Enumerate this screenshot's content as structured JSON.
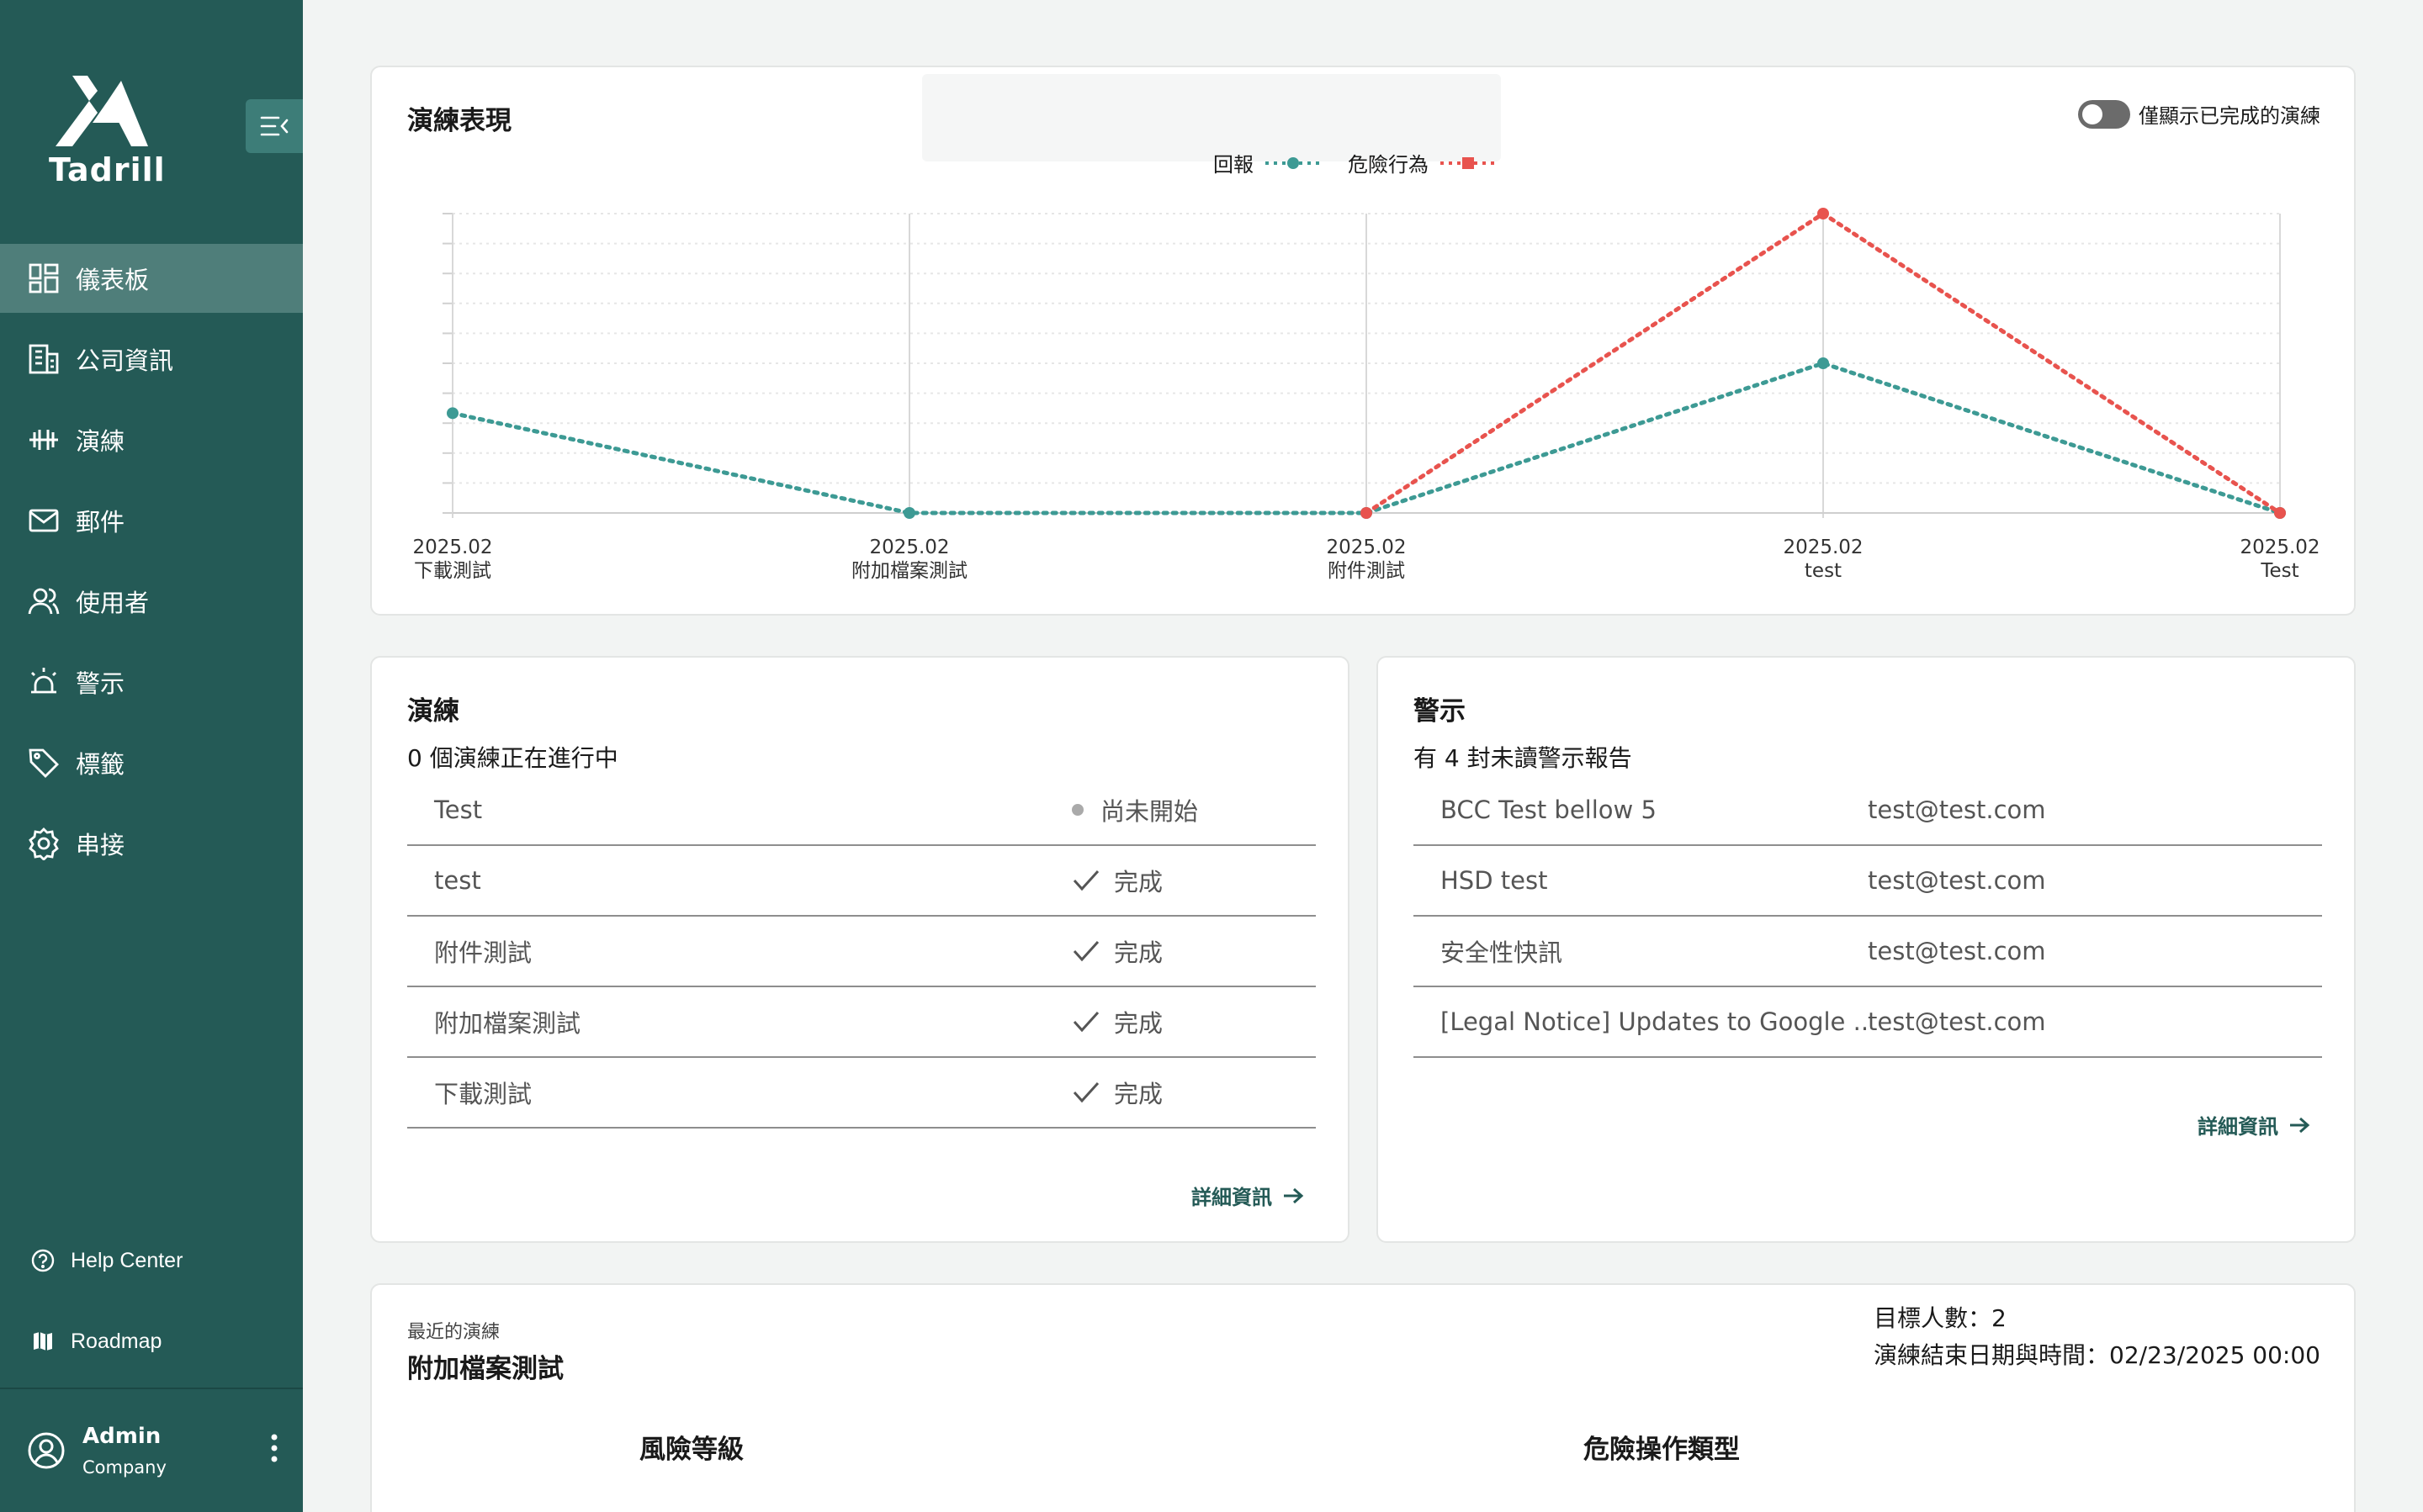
{
  "app": {
    "brand": "Tadrill"
  },
  "sidebar": {
    "collapse_icon": "collapse-menu-icon",
    "items": [
      {
        "label": "儀表板",
        "icon": "dashboard-icon",
        "active": true
      },
      {
        "label": "公司資訊",
        "icon": "building-icon",
        "active": false
      },
      {
        "label": "演練",
        "icon": "dumbbell-icon",
        "active": false
      },
      {
        "label": "郵件",
        "icon": "mail-icon",
        "active": false
      },
      {
        "label": "使用者",
        "icon": "users-icon",
        "active": false
      },
      {
        "label": "警示",
        "icon": "alarm-icon",
        "active": false
      },
      {
        "label": "標籤",
        "icon": "tag-icon",
        "active": false
      },
      {
        "label": "串接",
        "icon": "gear-icon",
        "active": false
      }
    ],
    "help_center": "Help Center",
    "roadmap": "Roadmap",
    "user": {
      "name": "Admin",
      "company": "Company"
    }
  },
  "performance": {
    "title": "演練表現",
    "toggle_label": "僅顯示已完成的演練",
    "toggle_on": false
  },
  "chart_data": {
    "type": "line",
    "categories": [
      {
        "date": "2025.02",
        "name": "下載測試"
      },
      {
        "date": "2025.02",
        "name": "附加檔案測試"
      },
      {
        "date": "2025.02",
        "name": "附件測試"
      },
      {
        "date": "2025.02",
        "name": "test"
      },
      {
        "date": "2025.02",
        "name": "Test"
      }
    ],
    "series": [
      {
        "name": "回報",
        "values": [
          2,
          0,
          0,
          3,
          0
        ],
        "color": "#3d9a94"
      },
      {
        "name": "危險行為",
        "values": [
          null,
          null,
          0,
          6,
          0
        ],
        "color": "#e8534e"
      }
    ],
    "ylim": [
      0,
      6
    ],
    "grid": true,
    "legend": "top-center"
  },
  "drills": {
    "title": "演練",
    "summary": "0 個演練正在進行中",
    "rows": [
      {
        "name": "Test",
        "status": "尚未開始",
        "status_icon": "dot"
      },
      {
        "name": "test",
        "status": "完成",
        "status_icon": "check"
      },
      {
        "name": "附件測試",
        "status": "完成",
        "status_icon": "check"
      },
      {
        "name": "附加檔案測試",
        "status": "完成",
        "status_icon": "check"
      },
      {
        "name": "下載測試",
        "status": "完成",
        "status_icon": "check"
      }
    ],
    "more": "詳細資訊"
  },
  "alerts": {
    "title": "警示",
    "summary": "有 4 封未讀警示報告",
    "rows": [
      {
        "subject": "BCC Test bellow 5",
        "email": "test@test.com"
      },
      {
        "subject": "HSD test",
        "email": "test@test.com"
      },
      {
        "subject": "安全性快訊",
        "email": "test@test.com"
      },
      {
        "subject": "[Legal Notice] Updates to Google ...",
        "email": "test@test.com"
      }
    ],
    "more": "詳細資訊"
  },
  "recent": {
    "label": "最近的演練",
    "name": "附加檔案測試",
    "targets": "目標人數：2",
    "end": "演練結束日期與時間：02/23/2025 00:00",
    "risk_title": "風險等級",
    "danger_title": "危險操作類型"
  }
}
